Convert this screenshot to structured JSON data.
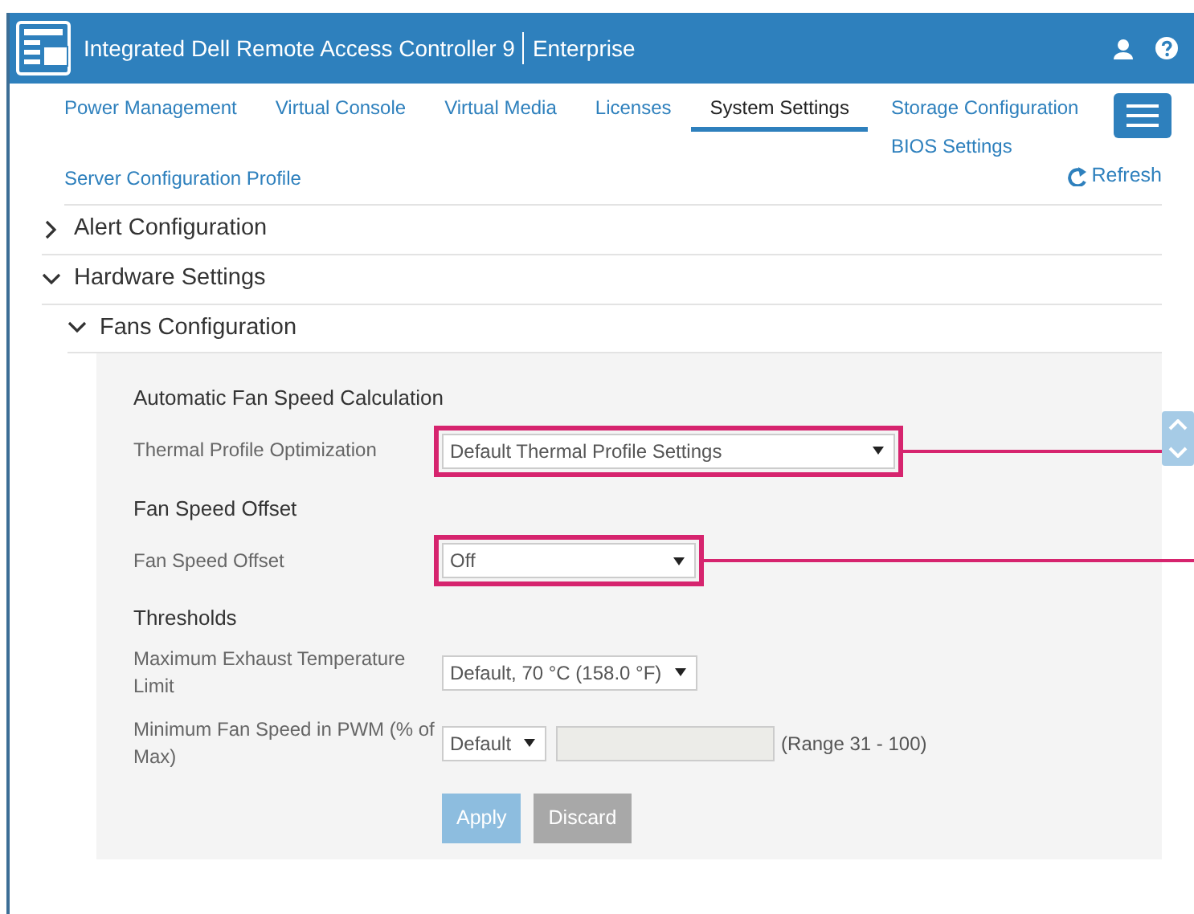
{
  "header": {
    "title": "Integrated Dell Remote Access Controller 9",
    "edition": "Enterprise"
  },
  "tabs": [
    {
      "label": "Power Management",
      "selected": false
    },
    {
      "label": "Virtual Console",
      "selected": false
    },
    {
      "label": "Virtual Media",
      "selected": false
    },
    {
      "label": "Licenses",
      "selected": false
    },
    {
      "label": "System Settings",
      "selected": true
    },
    {
      "label": "Storage Configuration",
      "selected": false
    }
  ],
  "overflow_tabs": [
    {
      "label": "BIOS Settings",
      "selected": false
    }
  ],
  "second_row_tabs": [
    {
      "label": "Server Configuration Profile",
      "selected": false
    }
  ],
  "refresh": "Refresh",
  "sections": [
    {
      "title": "Alert Configuration",
      "expanded": false
    },
    {
      "title": "Hardware Settings",
      "expanded": true,
      "children": [
        {
          "title": "Fans Configuration",
          "expanded": true
        }
      ]
    }
  ],
  "form": {
    "groups": [
      {
        "heading": "Automatic Fan Speed Calculation",
        "fields": [
          {
            "label": "Thermal Profile Optimization",
            "kind": "select",
            "value": "Default Thermal Profile Settings",
            "highlighted": true
          }
        ]
      },
      {
        "heading": "Fan Speed Offset",
        "fields": [
          {
            "label": "Fan Speed Offset",
            "kind": "select",
            "value": "Off",
            "highlighted": true
          }
        ]
      },
      {
        "heading": "Thresholds",
        "fields": [
          {
            "label": "Maximum Exhaust Temperature Limit",
            "kind": "select",
            "value": "Default, 70 °C (158.0 °F)",
            "highlighted": false
          },
          {
            "label": "Minimum Fan Speed in PWM (% of Max)",
            "kind": "select_range",
            "value": "Default",
            "highlighted": false,
            "input_disabled": true,
            "range": "(Range 31 - 100)"
          }
        ]
      }
    ],
    "buttons": [
      {
        "label": "Apply",
        "kind": "primary",
        "disabled": true
      },
      {
        "label": "Discard",
        "kind": "secondary",
        "disabled": true
      }
    ]
  }
}
